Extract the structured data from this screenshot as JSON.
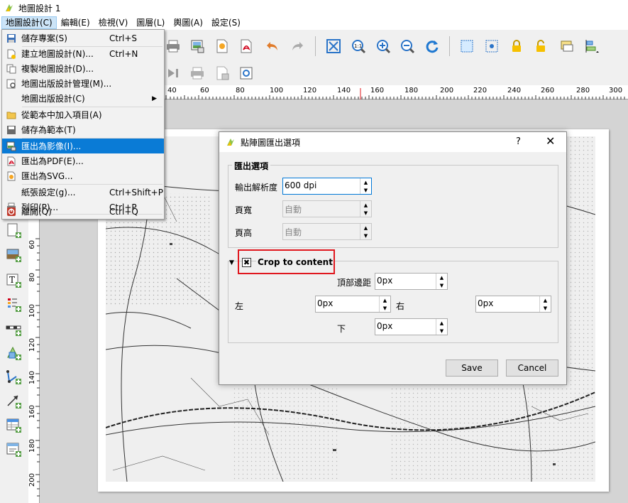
{
  "window": {
    "title": "地圖設計 1"
  },
  "menubar": [
    "地圖設計(C)",
    "編輯(E)",
    "檢視(V)",
    "圖層(L)",
    "輿圖(A)",
    "設定(S)"
  ],
  "menu": {
    "items": [
      {
        "label": "儲存專案(S)",
        "shortcut": "Ctrl+S",
        "icon": "save-icon"
      },
      {
        "label": "建立地圖設計(N)...",
        "shortcut": "Ctrl+N",
        "icon": "new-layout-icon"
      },
      {
        "label": "複製地圖設計(D)...",
        "shortcut": "",
        "icon": "duplicate-layout-icon"
      },
      {
        "label": "地圖出版設計管理(M)...",
        "shortcut": "",
        "icon": "layout-manager-icon"
      },
      {
        "label": "地圖出版設計(C)",
        "shortcut": "",
        "icon": "",
        "submenu": true
      },
      {
        "label": "從範本中加入項目(A)",
        "shortcut": "",
        "icon": "folder-icon"
      },
      {
        "label": "儲存為範本(T)",
        "shortcut": "",
        "icon": "save-template-icon"
      },
      {
        "label": "匯出為影像(I)...",
        "shortcut": "",
        "icon": "export-image-icon",
        "highlighted": true
      },
      {
        "label": "匯出為PDF(E)...",
        "shortcut": "",
        "icon": "export-pdf-icon"
      },
      {
        "label": "匯出為SVG...",
        "shortcut": "",
        "icon": "export-svg-icon"
      },
      {
        "label": "紙張設定(g)...",
        "shortcut": "Ctrl+Shift+P",
        "icon": ""
      },
      {
        "label": "列印(P)...",
        "shortcut": "Ctrl+P",
        "icon": "print-icon"
      },
      {
        "label": "離開(Q)",
        "shortcut": "Ctrl+Q",
        "icon": "exit-icon"
      }
    ]
  },
  "ruler": {
    "h": [
      "40",
      "60",
      "80",
      "100",
      "120",
      "140",
      "160",
      "180",
      "200",
      "220",
      "240",
      "260",
      "280",
      "300"
    ],
    "v": [
      "60",
      "80",
      "100",
      "120",
      "140",
      "160",
      "180",
      "200"
    ]
  },
  "dialog": {
    "title": "點陣圖匯出選項",
    "help": "?",
    "close": "✕",
    "export_group": "匯出選項",
    "resolution_label": "輸出解析度",
    "resolution_value": "600 dpi",
    "width_label": "頁寬",
    "width_value": "自動",
    "height_label": "頁高",
    "height_value": "自動",
    "crop_label": "Crop to content",
    "crop_checked": "✖",
    "top_label": "頂部邊距",
    "top_value": "0px",
    "left_label": "左",
    "left_value": "0px",
    "right_label": "右",
    "right_value": "0px",
    "bottom_label": "下",
    "bottom_value": "0px",
    "save": "Save",
    "cancel": "Cancel"
  }
}
